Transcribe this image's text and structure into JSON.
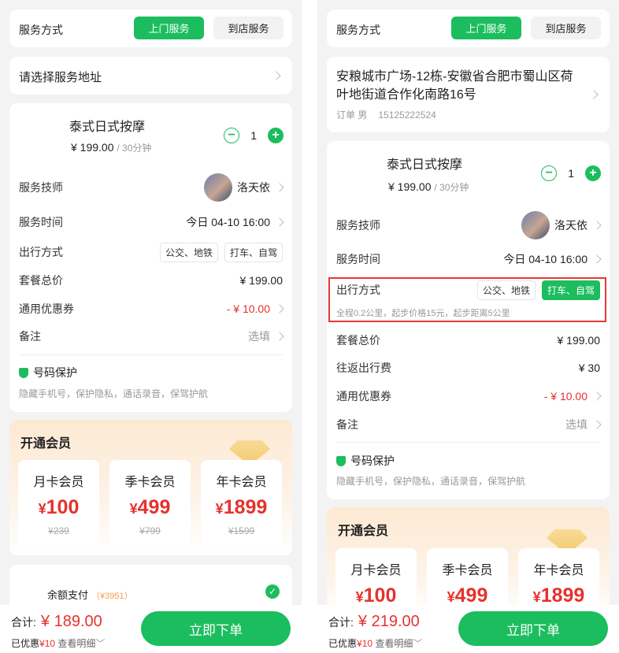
{
  "service_method": {
    "label": "服务方式",
    "home": "上门服务",
    "store": "到店服务"
  },
  "left": {
    "address_prompt": "请选择服务地址",
    "item": {
      "name": "泰式日式按摩",
      "price": "¥ 199.00",
      "duration": "/ 30分钟",
      "qty": "1"
    },
    "technician": {
      "label": "服务技师",
      "name": "洛天依"
    },
    "time": {
      "label": "服务时间",
      "value": "今日 04-10 16:00"
    },
    "travel": {
      "label": "出行方式",
      "options": [
        "公交、地铁",
        "打车、自驾"
      ]
    },
    "package_total": {
      "label": "套餐总价",
      "value": "¥ 199.00"
    },
    "coupon": {
      "label": "通用优惠券",
      "value": "- ¥ 10.00"
    },
    "remark": {
      "label": "备注",
      "value": "选填"
    },
    "privacy": {
      "title": "号码保护",
      "desc": "隐藏手机号，保护隐私，通话录音，保驾护航"
    },
    "membership": {
      "title": "开通会员",
      "cards": [
        {
          "name": "月卡会员",
          "price": "100",
          "original": "¥239"
        },
        {
          "name": "季卡会员",
          "price": "499",
          "original": "¥799"
        },
        {
          "name": "年卡会员",
          "price": "1899",
          "original": "¥1599"
        }
      ]
    },
    "balance": {
      "label": "余额支付",
      "amount": "（¥3951）"
    },
    "bottom": {
      "total_label": "合计:",
      "total": "¥ 189.00",
      "discount_prefix": "已优惠",
      "discount": "¥10",
      "detail": "查看明细",
      "submit": "立即下单"
    }
  },
  "right": {
    "address": {
      "line1": "安粮城市广场-12栋-安徽省合肥市蜀山区荷",
      "line2": "叶地街道合作化南路16号",
      "contact_name": "订单 男",
      "phone": "15125222524"
    },
    "item": {
      "name": "泰式日式按摩",
      "price": "¥ 199.00",
      "duration": "/ 30分钟",
      "qty": "1"
    },
    "technician": {
      "label": "服务技师",
      "name": "洛天依"
    },
    "time": {
      "label": "服务时间",
      "value": "今日 04-10 16:00"
    },
    "travel": {
      "label": "出行方式",
      "options": [
        "公交、地铁",
        "打车、自驾"
      ],
      "note": "全程0.2公里，起步价格15元，起步距离5公里"
    },
    "package_total": {
      "label": "套餐总价",
      "value": "¥ 199.00"
    },
    "round_trip": {
      "label": "往返出行费",
      "value": "¥ 30"
    },
    "coupon": {
      "label": "通用优惠券",
      "value": "- ¥ 10.00"
    },
    "remark": {
      "label": "备注",
      "value": "选填"
    },
    "privacy": {
      "title": "号码保护",
      "desc": "隐藏手机号，保护隐私，通话录音，保驾护航"
    },
    "membership": {
      "title": "开通会员",
      "cards": [
        {
          "name": "月卡会员",
          "price": "100"
        },
        {
          "name": "季卡会员",
          "price": "499"
        },
        {
          "name": "年卡会员",
          "price": "1899"
        }
      ]
    },
    "bottom": {
      "total_label": "合计:",
      "total": "¥ 219.00",
      "discount_prefix": "已优惠",
      "discount": "¥10",
      "detail": "查看明细",
      "submit": "立即下单"
    }
  },
  "colors": {
    "accent": "#1cbd5e",
    "price_red": "#e5322d",
    "highlight_border": "#e53935"
  }
}
